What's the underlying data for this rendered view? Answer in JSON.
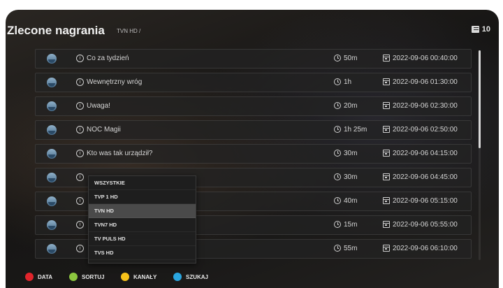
{
  "header": {
    "title": "Zlecone nagrania",
    "breadcrumb": "TVN HD /",
    "count": "10"
  },
  "icons": {
    "count": "list-icon",
    "row_avatar": "channel-avatar",
    "row_info": "info-icon",
    "row_duration": "clock-icon",
    "row_date": "calendar-icon"
  },
  "recordings": [
    {
      "title": "Co za tydzień",
      "duration": "50m",
      "datetime": "2022-09-06 00:40:00"
    },
    {
      "title": "Wewnętrzny wróg",
      "duration": "1h",
      "datetime": "2022-09-06 01:30:00"
    },
    {
      "title": "Uwaga!",
      "duration": "20m",
      "datetime": "2022-09-06 02:30:00"
    },
    {
      "title": "NOC Magii",
      "duration": "1h 25m",
      "datetime": "2022-09-06 02:50:00"
    },
    {
      "title": "Kto was tak urządził?",
      "duration": "30m",
      "datetime": "2022-09-06 04:15:00"
    },
    {
      "title": "",
      "duration": "30m",
      "datetime": "2022-09-06 04:45:00"
    },
    {
      "title": "",
      "duration": "40m",
      "datetime": "2022-09-06 05:15:00"
    },
    {
      "title": "",
      "duration": "15m",
      "datetime": "2022-09-06 05:55:00"
    },
    {
      "title": "",
      "duration": "55m",
      "datetime": "2022-09-06 06:10:00"
    }
  ],
  "channel_menu": {
    "items": [
      "WSZYSTKIE",
      "TVP 1 HD",
      "TVN HD",
      "TVN7 HD",
      "TV PULS HD",
      "TVS HD"
    ],
    "selected": "TVN HD"
  },
  "footer": {
    "items": [
      {
        "label": "DATA",
        "color": "#e0242b"
      },
      {
        "label": "SORTUJ",
        "color": "#8cc63f"
      },
      {
        "label": "KANAŁY",
        "color": "#f7c21a"
      },
      {
        "label": "SZUKAJ",
        "color": "#2aa6e0"
      }
    ]
  }
}
